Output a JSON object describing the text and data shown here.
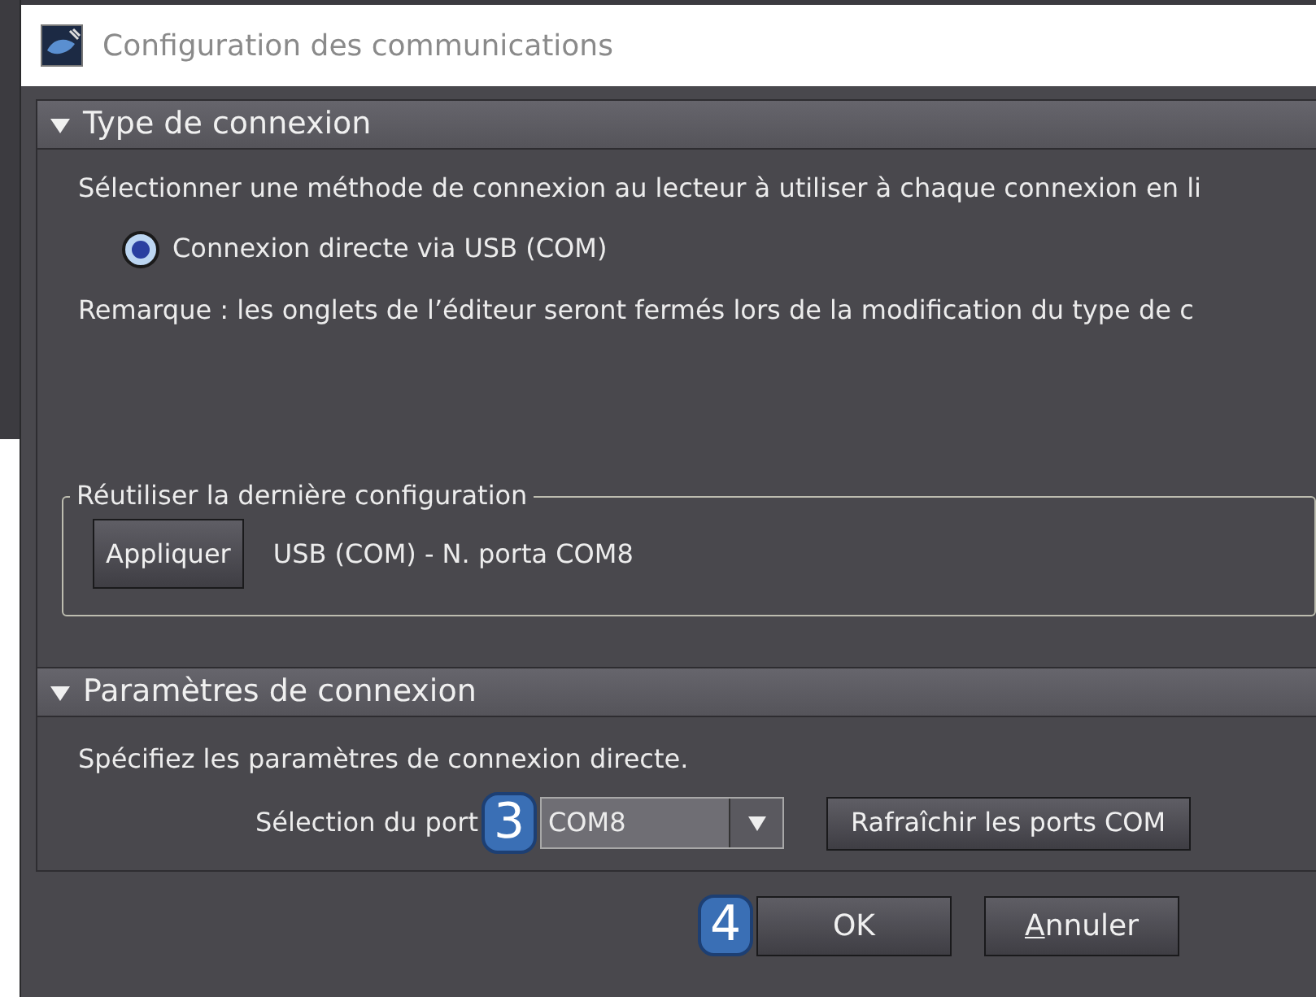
{
  "window": {
    "title": "Configuration des communications"
  },
  "connection_type": {
    "header": "Type de connexion",
    "expanded": true,
    "instruction": "Sélectionner une méthode de connexion au lecteur à utiliser à chaque connexion en li",
    "options": [
      {
        "label": "Connexion directe via USB (COM)",
        "selected": true
      }
    ],
    "note": "Remarque : les onglets de l’éditeur seront fermés lors de la modification du type de c",
    "reuse_group": {
      "legend": "Réutiliser la dernière configuration",
      "button": "Appliquer",
      "value": "USB (COM) - N. porta COM8"
    }
  },
  "connection_params": {
    "header": "Paramètres de connexion",
    "expanded": true,
    "instruction": "Spécifiez les paramètres de connexion directe.",
    "port_label": "Sélection du port",
    "port_value": "COM8",
    "refresh_button": "Rafraîchir les ports COM"
  },
  "buttons": [
    {
      "label": "OK",
      "underline_first": false
    },
    {
      "label": "Annuler",
      "underline_first": true
    }
  ],
  "callouts": [
    "3",
    "4"
  ]
}
